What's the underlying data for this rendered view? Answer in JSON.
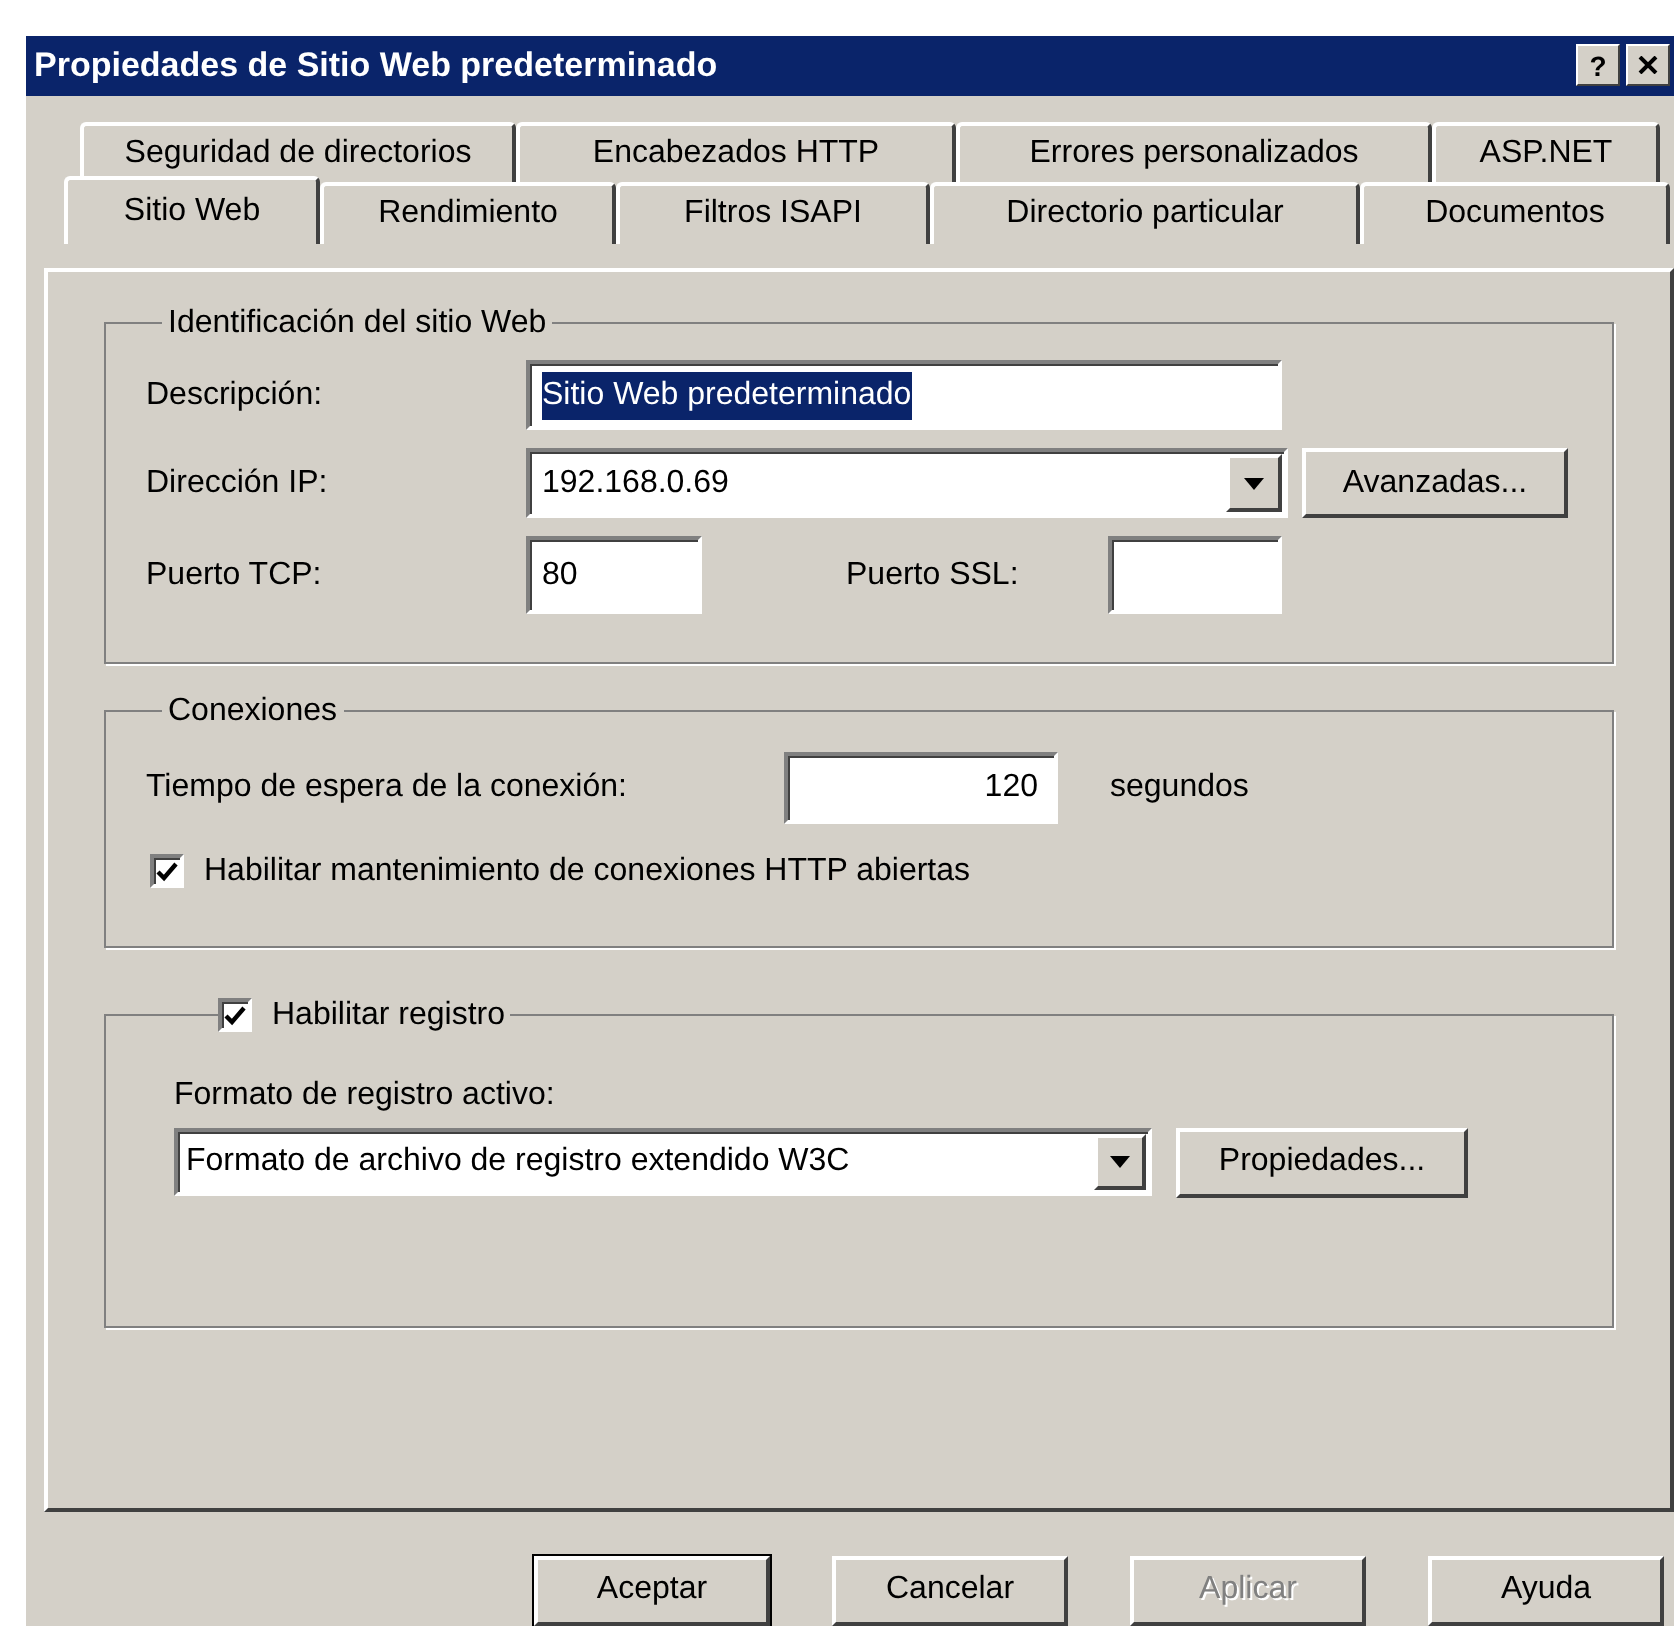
{
  "window": {
    "title": "Propiedades de Sitio Web predeterminado",
    "help_button": "?"
  },
  "tabs": [
    [
      {
        "label": "Seguridad de directorios",
        "selected": false
      },
      {
        "label": "Encabezados HTTP",
        "selected": false
      },
      {
        "label": "Errores personalizados",
        "selected": false
      },
      {
        "label": "ASP.NET",
        "selected": false
      }
    ],
    [
      {
        "label": "Sitio Web",
        "selected": true
      },
      {
        "label": "Rendimiento",
        "selected": false
      },
      {
        "label": "Filtros ISAPI",
        "selected": false
      },
      {
        "label": "Directorio particular",
        "selected": false
      },
      {
        "label": "Documentos",
        "selected": false
      }
    ]
  ],
  "identification": {
    "title": "Identificación del sitio Web",
    "description": {
      "label": "Descripción:",
      "value": "Sitio Web predeterminado",
      "text_selected": true
    },
    "ip_address": {
      "label": "Dirección IP:",
      "value": "192.168.0.69"
    },
    "advanced_button": "Avanzadas...",
    "tcp_port": {
      "label": "Puerto TCP:",
      "value": "80"
    },
    "ssl_port": {
      "label": "Puerto SSL:"
    }
  },
  "connections": {
    "title": "Conexiones",
    "timeout": {
      "label": "Tiempo de espera de la conexión:",
      "value": "120",
      "unit": "segundos"
    },
    "keep_alive": {
      "label": "Habilitar mantenimiento de conexiones HTTP abiertas",
      "checked": true
    }
  },
  "logging": {
    "enable": {
      "label": "Habilitar registro",
      "checked": true
    },
    "format_label": "Formato de registro activo:",
    "format": {
      "value": "Formato de archivo de registro extendido W3C"
    },
    "properties_button": "Propiedades..."
  },
  "buttons": [
    {
      "label": "Aceptar",
      "default": true,
      "disabled": false
    },
    {
      "label": "Cancelar",
      "default": false,
      "disabled": false
    },
    {
      "label": "Aplicar",
      "default": false,
      "disabled": true
    },
    {
      "label": "Ayuda",
      "default": false,
      "disabled": false
    }
  ]
}
